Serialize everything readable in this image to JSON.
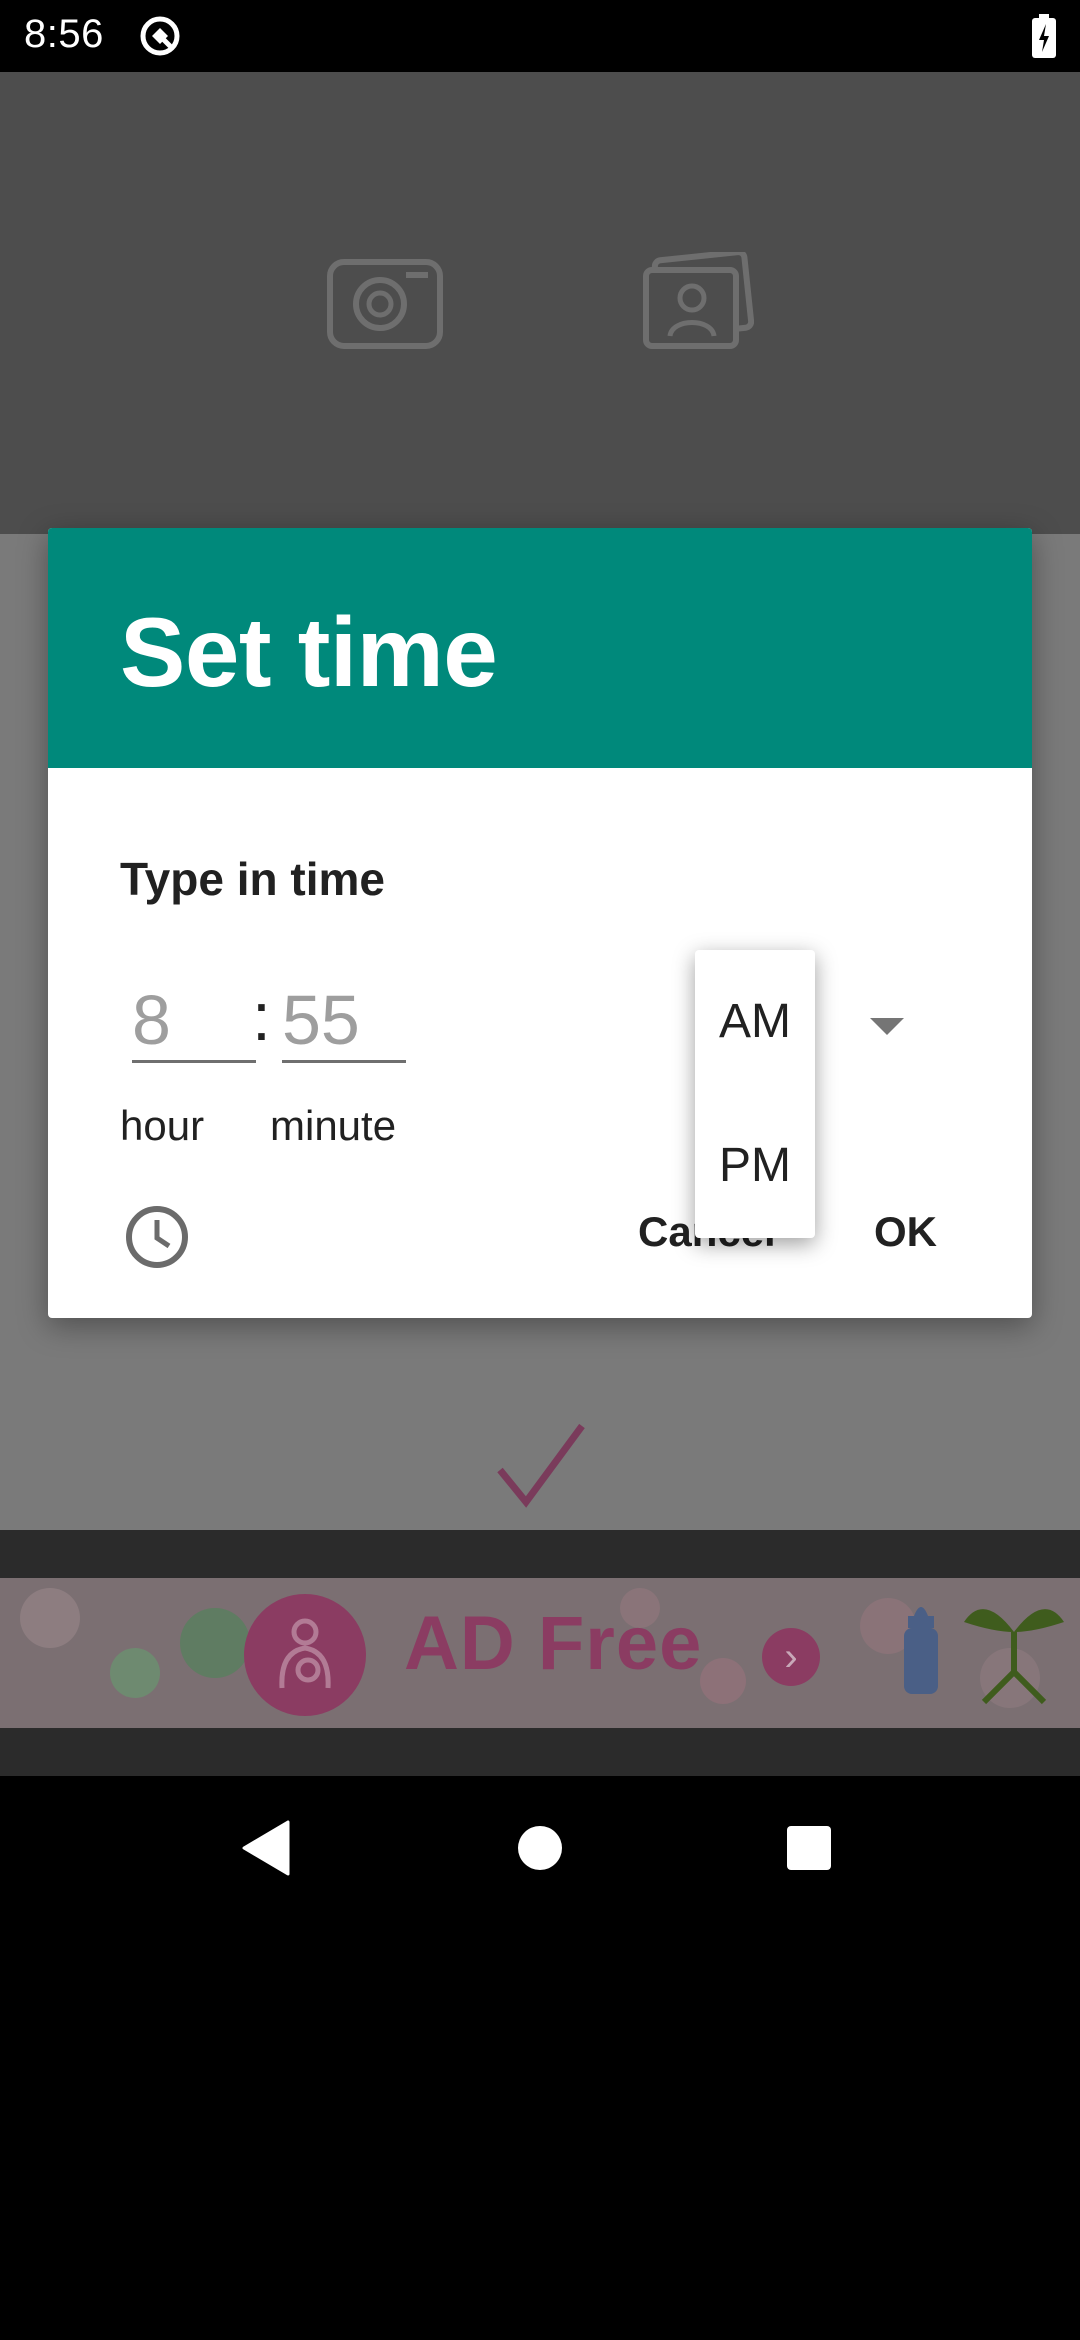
{
  "status_bar": {
    "time": "8:56",
    "icons": [
      "app-notification-icon",
      "battery-charging-icon"
    ]
  },
  "background_app": {
    "icons": [
      "camera-icon",
      "gallery-icon",
      "checkmark-icon"
    ],
    "ad_banner": {
      "text": "AD Free",
      "colors": {
        "text": "#8b3c62"
      }
    }
  },
  "dialog": {
    "title": "Set time",
    "subtitle": "Type in time",
    "hour": {
      "value": "8",
      "label": "hour"
    },
    "separator": ":",
    "minute": {
      "value": "55",
      "label": "minute"
    },
    "ampm_options": [
      "AM",
      "PM"
    ],
    "actions": {
      "cancel": "Cancel",
      "ok": "OK"
    },
    "colors": {
      "header": "#00897b"
    }
  },
  "nav_bar": {
    "icons": [
      "back-icon",
      "home-icon",
      "recents-icon"
    ]
  }
}
